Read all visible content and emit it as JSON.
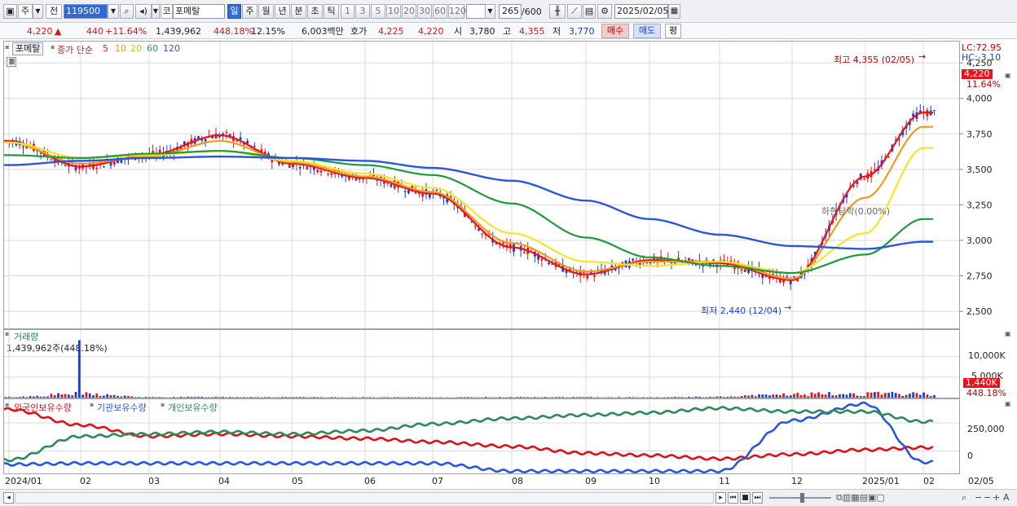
{
  "toolbar": {
    "market": "주",
    "prev_label": "전",
    "code": "119500",
    "name_prefix": "코",
    "name": "포메탈",
    "periods": [
      "일",
      "주",
      "월",
      "년",
      "분",
      "초",
      "틱"
    ],
    "period_selected": "일",
    "intervals": [
      "1",
      "3",
      "5",
      "10",
      "20",
      "30",
      "60",
      "120"
    ],
    "count": "265",
    "count_total": "/600",
    "date": "2025/02/05"
  },
  "quote": {
    "price": "4,220",
    "arrow": "▲",
    "change": "440",
    "change_pct": "+11.64%",
    "volume": "1,439,962",
    "volume_ratio": "448.18%",
    "turnover": "12.15%",
    "amount": "6,003백만",
    "hoga_label": "호가",
    "ask": "4,225",
    "bid": "4,220",
    "open_label": "시",
    "open": "3,780",
    "high_label": "고",
    "high": "4,355",
    "low_label": "저",
    "low": "3,770",
    "buy_label": "매수",
    "sell_label": "매도",
    "eval_label": "평"
  },
  "price_panel": {
    "name_tag": "포메탈",
    "ma_prefix": "종가 단순",
    "ma_periods": [
      "5",
      "10",
      "20",
      "60",
      "120"
    ],
    "ma_colors": [
      "#e8141a",
      "#f39a1c",
      "#f5e428",
      "#1d9a3a",
      "#2b56d8"
    ],
    "high_annotation": "최고 4,355 (02/05)",
    "low_annotation": "최저 2,440 (12/04)",
    "mid_annotation": "하한당락(0.00%)",
    "lc": "LC:72.95",
    "hc": "HC:-3.10",
    "current_price_tag": "4,220",
    "current_pct_tag": "11.64%",
    "y_ticks": [
      "4,250",
      "4,000",
      "3,750",
      "3,500",
      "3,250",
      "3,000",
      "2,750",
      "2,500"
    ]
  },
  "volume_panel": {
    "title": "거래량",
    "value": "1,439,962주(448.18%)",
    "y_ticks": [
      "10,000K",
      "5,000K"
    ],
    "tag_value": "1,440K",
    "tag_pct": "448.18%"
  },
  "holdings_panel": {
    "series": [
      {
        "name": "외국인보유수량",
        "color": "#d8141b"
      },
      {
        "name": "기관보유수량",
        "color": "#2b56d8"
      },
      {
        "name": "개인보유수량",
        "color": "#2e8b57"
      }
    ],
    "y_ticks": [
      "250,000",
      "0"
    ]
  },
  "x_axis": {
    "labels": [
      "2024/01",
      "02",
      "03",
      "04",
      "05",
      "06",
      "07",
      "08",
      "09",
      "10",
      "11",
      "12",
      "2025/01",
      "02",
      "02/05"
    ]
  },
  "chart_data": [
    {
      "type": "line",
      "x": [
        "2024/01",
        "02",
        "03",
        "04",
        "05",
        "06",
        "07",
        "08",
        "09",
        "10",
        "11",
        "12",
        "2025/01",
        "02"
      ],
      "series": [
        {
          "name": "5",
          "values": [
            3700,
            3520,
            3600,
            3740,
            3540,
            3440,
            3330,
            2950,
            2760,
            2860,
            2840,
            2720,
            3450,
            3900
          ]
        },
        {
          "name": "10",
          "values": [
            3690,
            3540,
            3590,
            3700,
            3550,
            3450,
            3340,
            2980,
            2780,
            2850,
            2850,
            2730,
            3300,
            3800
          ]
        },
        {
          "name": "20",
          "values": [
            3690,
            3580,
            3600,
            3630,
            3560,
            3470,
            3370,
            3050,
            2850,
            2820,
            2850,
            2770,
            3050,
            3650
          ]
        },
        {
          "name": "60",
          "values": [
            3600,
            3580,
            3610,
            3630,
            3580,
            3530,
            3460,
            3260,
            3020,
            2880,
            2820,
            2770,
            2900,
            3150
          ]
        },
        {
          "name": "120",
          "values": [
            3530,
            3560,
            3580,
            3590,
            3580,
            3560,
            3510,
            3420,
            3280,
            3150,
            3040,
            2960,
            2940,
            2990
          ]
        }
      ],
      "ylim": [
        2380,
        4400
      ]
    },
    {
      "type": "bar",
      "title": "거래량",
      "values_note": "",
      "x": [
        "2024/01",
        "02",
        "03",
        "04",
        "05",
        "06",
        "07",
        "08",
        "09",
        "10",
        "11",
        "12",
        "2025/01",
        "02"
      ],
      "values": [
        150,
        14000,
        120,
        180,
        110,
        90,
        80,
        140,
        120,
        100,
        200,
        800,
        900,
        1440
      ],
      "ylim": [
        0,
        14500
      ]
    },
    {
      "type": "line",
      "x": [
        "2024/01",
        "02",
        "03",
        "04",
        "05",
        "06",
        "07",
        "08",
        "09",
        "10",
        "11",
        "12",
        "2025/01",
        "02"
      ],
      "series": [
        {
          "name": "외국인보유수량",
          "values": [
            370000,
            230000,
            130000,
            150000,
            130000,
            110000,
            80000,
            40000,
            -20000,
            -40000,
            -70000,
            -30000,
            10000,
            30000
          ]
        },
        {
          "name": "기관보유수량",
          "values": [
            -120000,
            -110000,
            -110000,
            -110000,
            -110000,
            -110000,
            -110000,
            -180000,
            -180000,
            -180000,
            -180000,
            270000,
            420000,
            -100000
          ]
        },
        {
          "name": "개인보유수량",
          "values": [
            -80000,
            130000,
            150000,
            170000,
            150000,
            180000,
            240000,
            290000,
            320000,
            340000,
            380000,
            350000,
            350000,
            260000
          ]
        }
      ],
      "ylim": [
        -200000,
        460000
      ]
    }
  ]
}
